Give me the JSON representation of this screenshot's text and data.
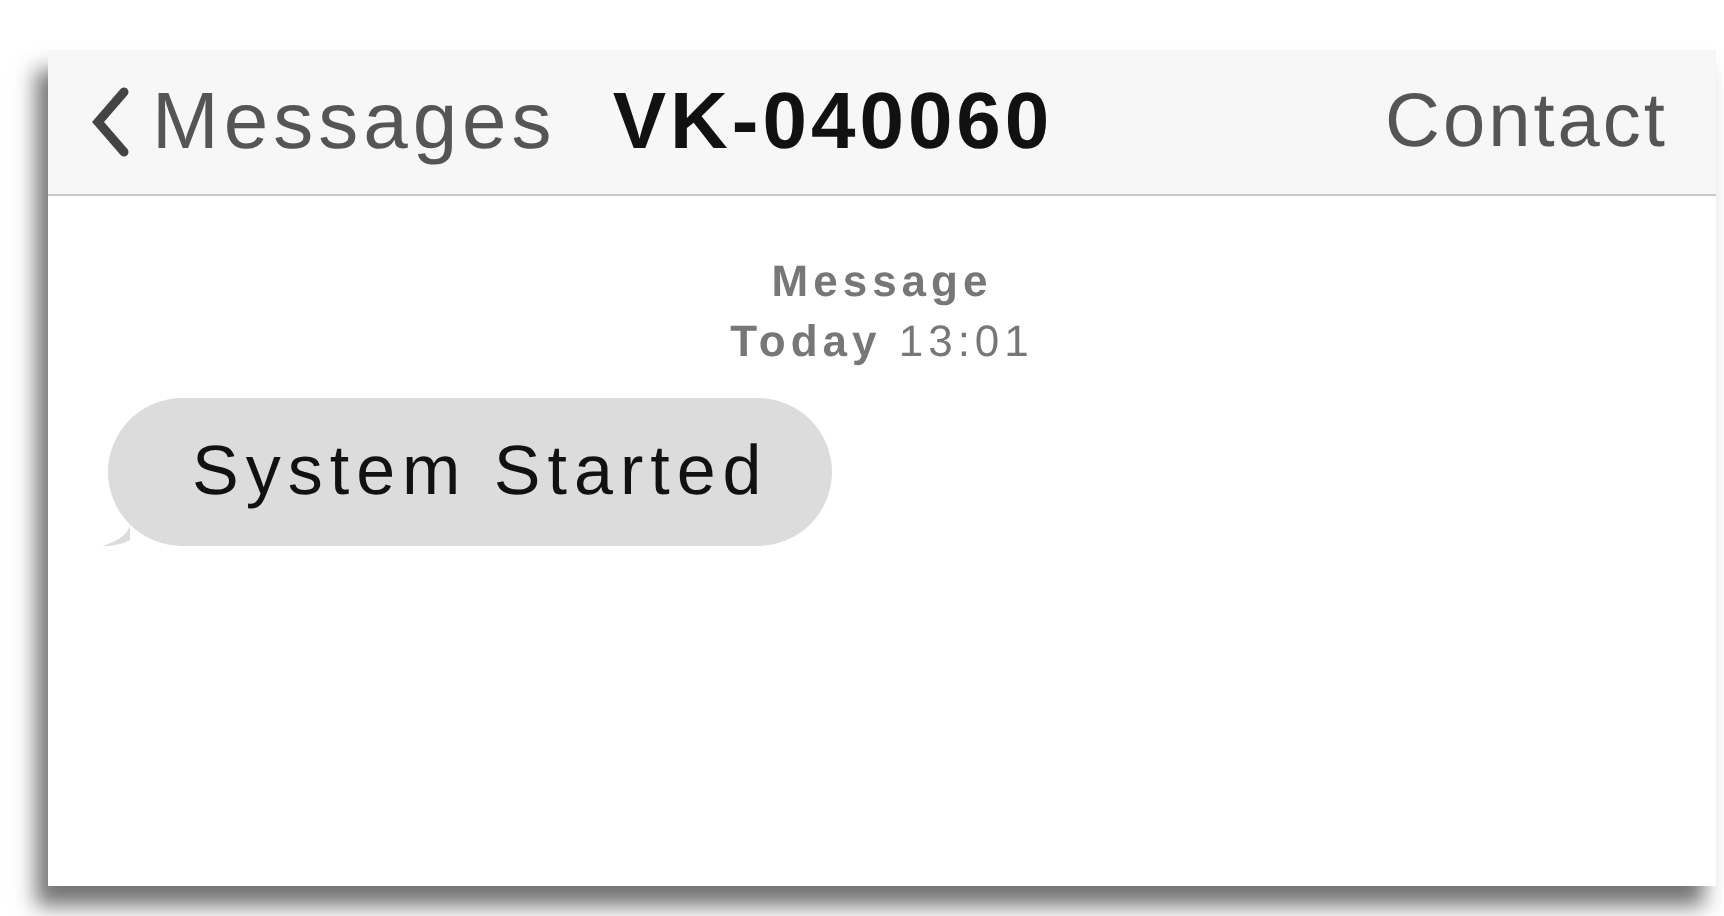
{
  "nav_bar": {
    "back_label": "Messages",
    "title": "VK-040060",
    "action": "Contact"
  },
  "timestamp": {
    "label": "Message",
    "time": "**Today** 13:01"
  },
  "messages": [
    {
      "text": "System Started",
      "kind": "incoming"
    }
  ]
}
